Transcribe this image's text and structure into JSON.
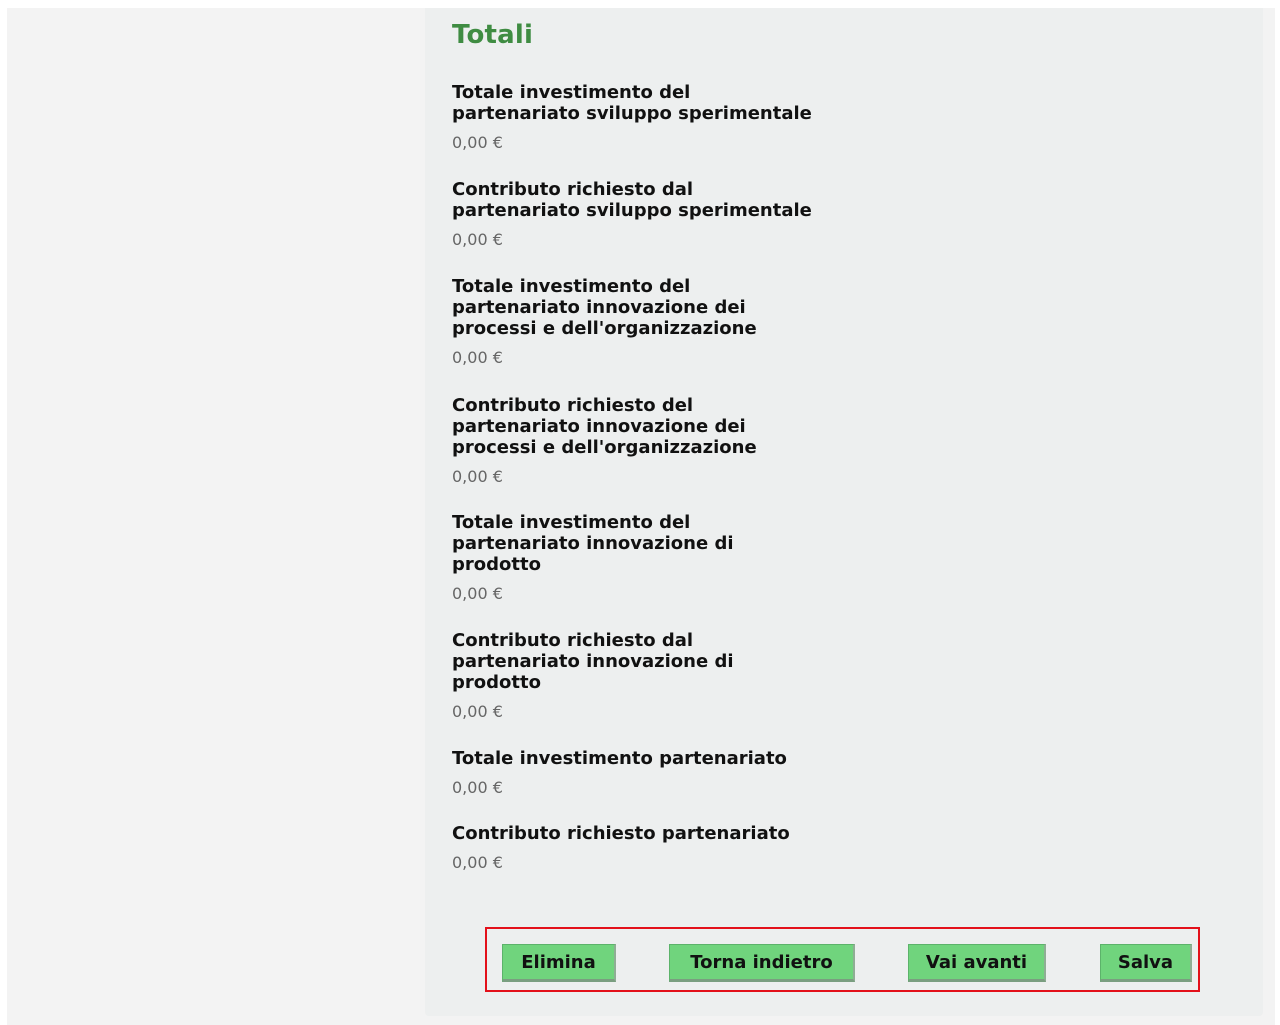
{
  "section": {
    "title": "Totali"
  },
  "fields": [
    {
      "label_lines": [
        "Totale investimento del",
        "partenariato sviluppo sperimentale"
      ],
      "value": "0,00 €"
    },
    {
      "label_lines": [
        "Contributo richiesto dal",
        "partenariato sviluppo sperimentale"
      ],
      "value": "0,00 €"
    },
    {
      "label_lines": [
        "Totale investimento del",
        "partenariato innovazione dei",
        "processi e dell'organizzazione"
      ],
      "value": "0,00 €"
    },
    {
      "label_lines": [
        "Contributo richiesto del",
        "partenariato innovazione dei",
        "processi e dell'organizzazione"
      ],
      "value": "0,00 €"
    },
    {
      "label_lines": [
        "Totale investimento del",
        "partenariato innovazione di",
        "prodotto"
      ],
      "value": "0,00 €"
    },
    {
      "label_lines": [
        "Contributo richiesto dal",
        "partenariato innovazione di",
        "prodotto"
      ],
      "value": "0,00 €"
    },
    {
      "label_lines": [
        "Totale investimento partenariato"
      ],
      "value": "0,00 €"
    },
    {
      "label_lines": [
        "Contributo richiesto partenariato"
      ],
      "value": "0,00 €"
    }
  ],
  "actions": {
    "delete_label": "Elimina",
    "back_label": "Torna indietro",
    "forward_label": "Vai avanti",
    "save_label": "Salva"
  },
  "colors": {
    "title_green": "#3f8c42",
    "button_green": "#70d47d",
    "highlight_red": "#e3101a",
    "panel_bg": "#edefef"
  }
}
